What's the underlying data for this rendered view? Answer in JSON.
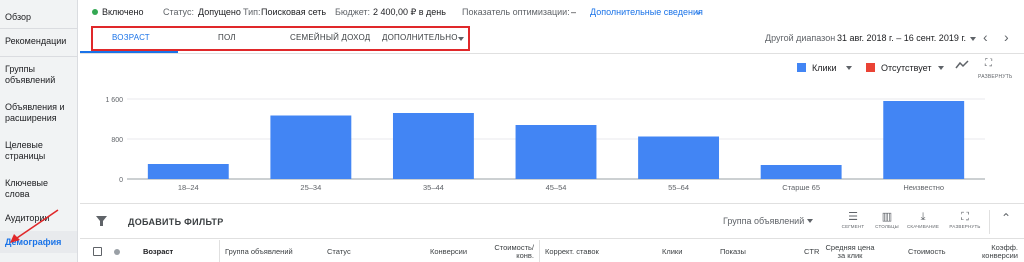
{
  "sidebar": {
    "items": [
      {
        "label": "Обзор"
      },
      {
        "label": "Рекомендации"
      },
      {
        "label": "Группы объявлений"
      },
      {
        "label": "Объявления и расширения"
      },
      {
        "label": "Целевые страницы"
      },
      {
        "label": "Ключевые слова"
      },
      {
        "label": "Аудитории"
      },
      {
        "label": "Демография",
        "active": true
      }
    ]
  },
  "status": {
    "state": "Включено",
    "status_label": "Статус:",
    "status_value": "Допущено",
    "type_label": "Тип:",
    "type_value": "Поисковая сеть",
    "budget_label": "Бюджет:",
    "budget_value": "2 400,00 ₽ в день",
    "opt_label": "Показатель оптимизации:",
    "opt_value": "–",
    "details_link": "Дополнительные сведения"
  },
  "tabs": [
    {
      "label": "ВОЗРАСТ",
      "active": true
    },
    {
      "label": "ПОЛ"
    },
    {
      "label": "СЕМЕЙНЫЙ ДОХОД"
    },
    {
      "label": "ДОПОЛНИТЕЛЬНО"
    }
  ],
  "date_range": {
    "label": "Другой диапазон",
    "value": "31 авг. 2018 г. – 16 сент. 2019 г."
  },
  "chart_controls": {
    "metric1": "Клики",
    "metric1_color": "#4285f4",
    "metric2": "Отсутствует",
    "metric2_color": "#ea4335",
    "expand_label": "РАЗВЕРНУТЬ"
  },
  "chart_data": {
    "type": "bar",
    "categories": [
      "18–24",
      "25–34",
      "35–44",
      "45–54",
      "55–64",
      "Старше 65",
      "Неизвестно"
    ],
    "series": [
      {
        "name": "Клики",
        "values": [
          300,
          1270,
          1320,
          1080,
          850,
          280,
          1560
        ]
      }
    ],
    "yticks": [
      "1 600",
      "800",
      "0"
    ],
    "ylim": [
      0,
      1600
    ],
    "color": "#4285f4"
  },
  "filter": {
    "add_label": "ДОБАВИТЬ ФИЛЬТР",
    "group_select": "Группа объявлений",
    "tools": [
      "СЕГМЕНТ",
      "СТОЛБЦЫ",
      "СКАЧИВАНИЕ",
      "РАЗВЕРНУТЬ"
    ]
  },
  "table_headers": {
    "age": "Возраст",
    "group": "Группа объявлений",
    "status": "Статус",
    "conversions": "Конверсии",
    "cost_conv_1": "Стоимость/",
    "cost_conv_2": "конв.",
    "bid_adj": "Коррект. ставок",
    "clicks": "Клики",
    "impressions": "Показы",
    "ctr": "CTR",
    "avg_cpc_1": "Средняя цена",
    "avg_cpc_2": "за клик",
    "cost": "Стоимость",
    "conv_rate_1": "Коэфф.",
    "conv_rate_2": "конверсии"
  }
}
